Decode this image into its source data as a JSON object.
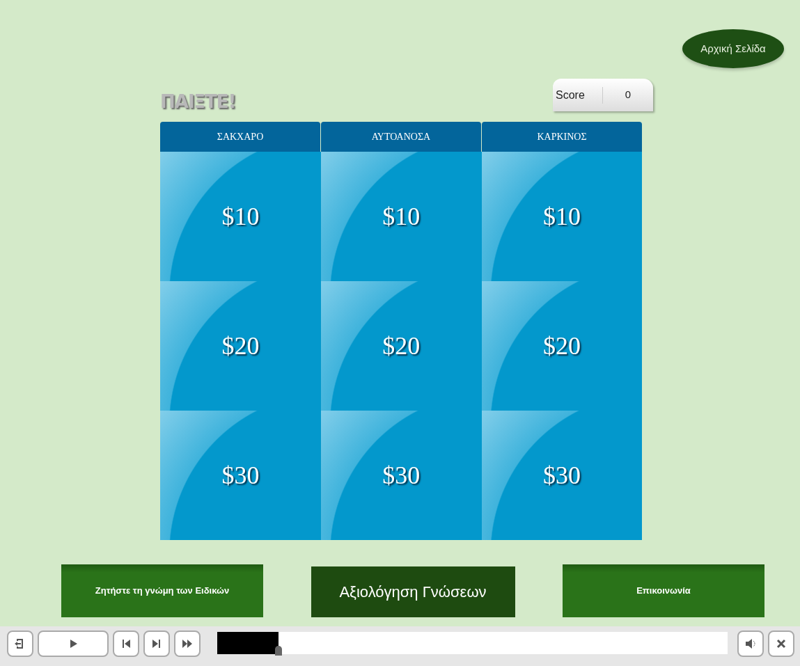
{
  "home_button": "Αρχική Σελίδα",
  "title": "ΠΑΙΞΤΕ!",
  "score": {
    "label": "Score",
    "value": "0"
  },
  "board": {
    "categories": [
      "ΣΑΚΧΑΡΟ",
      "ΑΥΤΟΑΝΟΣΑ",
      "ΚΑΡΚΙΝΟΣ"
    ],
    "rows": [
      [
        "$10",
        "$10",
        "$10"
      ],
      [
        "$20",
        "$20",
        "$20"
      ],
      [
        "$30",
        "$30",
        "$30"
      ]
    ]
  },
  "buttons": [
    {
      "label": "Ζητήστε τη γνώμη των Ειδικών",
      "kind": "normal"
    },
    {
      "label": "Αξιολόγηση Γνώσεων",
      "kind": "large"
    },
    {
      "label": "Επικοινωνία",
      "kind": "normal"
    }
  ],
  "playbar": {
    "level": 0.12
  }
}
